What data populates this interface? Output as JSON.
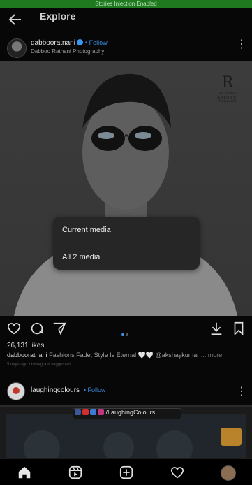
{
  "status_bar": {
    "text": "Stories Injection Enabled"
  },
  "header": {
    "title": "Explore",
    "back_icon": "arrow-left-icon"
  },
  "post": {
    "username": "dabbooratnani",
    "follow_label": "• Follow",
    "subtitle": "Dabboo Ratnani Photography",
    "image_watermark": {
      "mark": "R",
      "line1": "DABBOO RATNANI",
      "line2": "Photography"
    },
    "download_menu": {
      "items": [
        {
          "label": "Current media"
        },
        {
          "label": "All 2 media"
        }
      ]
    },
    "carousel": {
      "count": 2,
      "active_index": 0,
      "active_color": "#3897f0",
      "inactive_color": "#555555"
    },
    "likes": "26,131 likes",
    "caption_user": "dabbooratnani",
    "caption_text": "Fashions Fade, Style Is Eternal 🤍🤍 @akshaykumar",
    "caption_more": "... more",
    "meta": "5 days ago • Instagram suggested"
  },
  "next_post": {
    "username": "laughingcolours",
    "follow_label": "• Follow",
    "banner_text": "/LaughingColours"
  },
  "colors": {
    "accent": "#3897f0",
    "status_green": "#1f7a1f",
    "background": "#070707"
  }
}
